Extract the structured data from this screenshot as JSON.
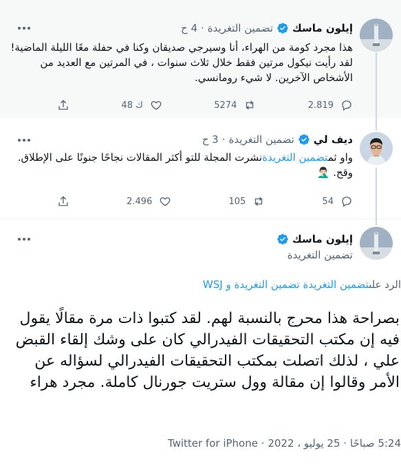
{
  "tweets": [
    {
      "author": "إيلون ماسك",
      "retweet_label": "تضمين التغريدة",
      "time": "4 ح",
      "text": "هذا مجرد كومة من الهراء، أنا وسيرجي صديقان وكنا في حفلة معًا الليلة الماضية! لقد رأيت نيكول مرتين فقط خلال ثلاث سنوات ، في المرتين مع العديد من الأشخاص الآخرين. لا شيء رومانسي.",
      "replies": "2.819",
      "retweets": "5274",
      "likes": "48 ك"
    },
    {
      "author": "ديف لي",
      "retweet_label": "تضمين التغريدة",
      "time": "3 ح",
      "text_prefix": "واو ثم",
      "text_mention": "تضمين التغريدة",
      "text_rest": "نشرت المجلة للتو أكثر المقالات نجاحًا جنونًا على الإطلاق. وقح.",
      "emoji": "🤦🏻‍♂️",
      "replies": "54",
      "retweets": "105",
      "likes": "2.496"
    }
  ],
  "focused": {
    "author": "إيلون ماسك",
    "handle": "تضمين التغريدة",
    "reply_prefix": "الرد على",
    "reply_mentions": "تضمين التغريدة تضمين التغريدة و WSJ",
    "text": "بصراحة هذا محرج بالنسبة لهم. لقد كتبوا ذات مرة مقالًا يقول فيه إن مكتب التحقيقات الفيدرالي كان على وشك إلقاء القبض علي ، لذلك اتصلت بمكتب التحقيقات الفيدرالي لسؤاله عن الأمر وقالوا إن مقالة وول ستريت جورنال كاملة. مجرد هراء",
    "time": "5:24 صباحًا",
    "date": "25 يوليو ، 2022",
    "separator": "·",
    "client": "Twitter for iPhone"
  },
  "colors": {
    "accent": "#1d9bf0",
    "muted": "#536471",
    "text": "#0f1419",
    "highlight_bg": "#f7f9f9"
  },
  "icons": [
    "more-icon",
    "verified-badge-icon",
    "reply-icon",
    "retweet-icon",
    "like-icon",
    "share-icon"
  ]
}
